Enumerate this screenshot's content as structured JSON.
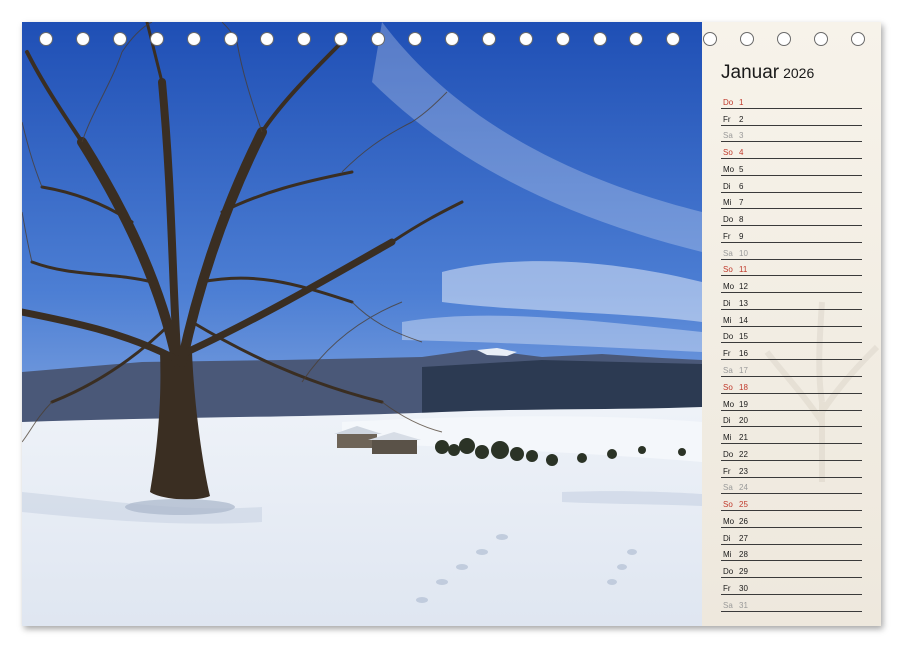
{
  "calendar": {
    "month": "Januar",
    "year": "2026",
    "days": [
      {
        "name": "Do",
        "num": "1",
        "type": "sun"
      },
      {
        "name": "Fr",
        "num": "2",
        "type": "work"
      },
      {
        "name": "Sa",
        "num": "3",
        "type": "sat"
      },
      {
        "name": "So",
        "num": "4",
        "type": "sun"
      },
      {
        "name": "Mo",
        "num": "5",
        "type": "work"
      },
      {
        "name": "Di",
        "num": "6",
        "type": "work"
      },
      {
        "name": "Mi",
        "num": "7",
        "type": "work"
      },
      {
        "name": "Do",
        "num": "8",
        "type": "work"
      },
      {
        "name": "Fr",
        "num": "9",
        "type": "work"
      },
      {
        "name": "Sa",
        "num": "10",
        "type": "sat"
      },
      {
        "name": "So",
        "num": "11",
        "type": "sun"
      },
      {
        "name": "Mo",
        "num": "12",
        "type": "work"
      },
      {
        "name": "Di",
        "num": "13",
        "type": "work"
      },
      {
        "name": "Mi",
        "num": "14",
        "type": "work"
      },
      {
        "name": "Do",
        "num": "15",
        "type": "work"
      },
      {
        "name": "Fr",
        "num": "16",
        "type": "work"
      },
      {
        "name": "Sa",
        "num": "17",
        "type": "sat"
      },
      {
        "name": "So",
        "num": "18",
        "type": "sun"
      },
      {
        "name": "Mo",
        "num": "19",
        "type": "work"
      },
      {
        "name": "Di",
        "num": "20",
        "type": "work"
      },
      {
        "name": "Mi",
        "num": "21",
        "type": "work"
      },
      {
        "name": "Do",
        "num": "22",
        "type": "work"
      },
      {
        "name": "Fr",
        "num": "23",
        "type": "work"
      },
      {
        "name": "Sa",
        "num": "24",
        "type": "sat"
      },
      {
        "name": "So",
        "num": "25",
        "type": "sun"
      },
      {
        "name": "Mo",
        "num": "26",
        "type": "work"
      },
      {
        "name": "Di",
        "num": "27",
        "type": "work"
      },
      {
        "name": "Mi",
        "num": "28",
        "type": "work"
      },
      {
        "name": "Do",
        "num": "29",
        "type": "work"
      },
      {
        "name": "Fr",
        "num": "30",
        "type": "work"
      },
      {
        "name": "Sa",
        "num": "31",
        "type": "sat"
      }
    ],
    "colors": {
      "sunday": "#c0392b",
      "saturday": "#9a9a9a",
      "workday": "#1a1a1a",
      "panel": "#f3efe6"
    }
  },
  "binding": {
    "hole_count": 23
  },
  "photo": {
    "subject": "winter landscape with bare tree"
  }
}
